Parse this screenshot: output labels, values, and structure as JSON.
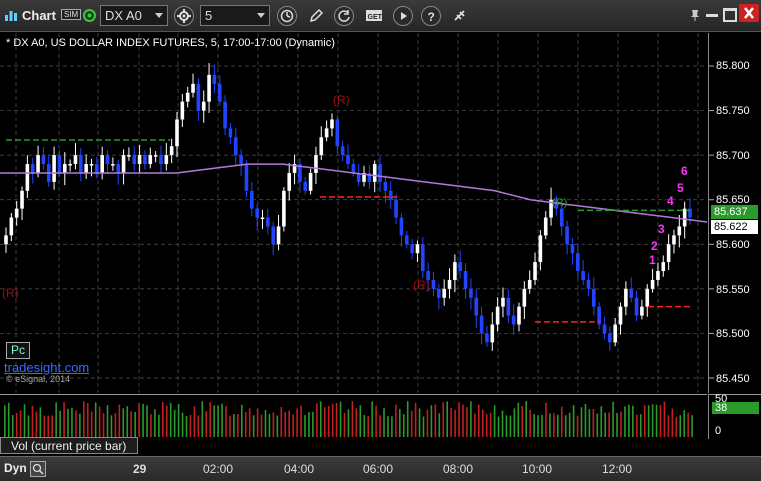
{
  "toolbar": {
    "app_label": "Chart",
    "sim_badge": "SIM",
    "symbol": "DX A0",
    "interval": "5"
  },
  "chart_title": "* DX A0, US DOLLAR INDEX FUTURES, 5, 17:00-17:00 (Dynamic)",
  "price_axis": {
    "ticks": [
      "85.800",
      "85.750",
      "85.700",
      "85.650",
      "85.600",
      "85.550",
      "85.500",
      "85.450"
    ],
    "last_price": "85.637",
    "ma_value": "85.622"
  },
  "volume_axis": {
    "ticks": [
      "50",
      "0"
    ],
    "last_volume": "38"
  },
  "volume_panel_label": "Vol (current price bar)",
  "pc_button": "Pc",
  "watermark": "tradesight.com",
  "copyright": "© eSignal, 2014",
  "time_axis": {
    "mode": "Dyn",
    "labels": [
      "29",
      "02:00",
      "04:00",
      "06:00",
      "08:00",
      "10:00",
      "12:00"
    ]
  },
  "annotations": {
    "r_left": "(R)",
    "r_top": "(R)",
    "r_mid": "(R)",
    "r_right": "(R)",
    "setup_counts": [
      "1",
      "2",
      "3",
      "4",
      "5",
      "6"
    ]
  },
  "colors": {
    "up_bar": "#ffffff",
    "down_bar": "#2244ff",
    "moving_average": "#b07ad8",
    "resistance": "#2a9a2a",
    "support": "#ff2222",
    "setup_count": "#ff33ff",
    "r_label": "#a01010"
  },
  "chart_data": {
    "type": "candlestick",
    "price_ylim": [
      85.45,
      85.82
    ],
    "x_tick_labels": [
      "29",
      "02:00",
      "04:00",
      "06:00",
      "08:00",
      "10:00",
      "12:00"
    ],
    "price_ticks": [
      85.8,
      85.75,
      85.7,
      85.65,
      85.6,
      85.55,
      85.5,
      85.45
    ],
    "close_path": [
      85.61,
      85.63,
      85.64,
      85.66,
      85.69,
      85.68,
      85.7,
      85.69,
      85.67,
      85.7,
      85.68,
      85.69,
      85.69,
      85.7,
      85.68,
      85.69,
      85.69,
      85.68,
      85.7,
      85.69,
      85.69,
      85.68,
      85.7,
      85.7,
      85.69,
      85.7,
      85.69,
      85.7,
      85.7,
      85.69,
      85.7,
      85.71,
      85.74,
      85.76,
      85.77,
      85.78,
      85.75,
      85.76,
      85.79,
      85.78,
      85.76,
      85.73,
      85.72,
      85.7,
      85.69,
      85.66,
      85.64,
      85.63,
      85.63,
      85.62,
      85.6,
      85.62,
      85.66,
      85.68,
      85.69,
      85.67,
      85.66,
      85.68,
      85.7,
      85.72,
      85.73,
      85.74,
      85.71,
      85.7,
      85.69,
      85.68,
      85.67,
      85.68,
      85.67,
      85.69,
      85.67,
      85.66,
      85.65,
      85.63,
      85.61,
      85.6,
      85.59,
      85.6,
      85.57,
      85.56,
      85.55,
      85.54,
      85.55,
      85.56,
      85.58,
      85.57,
      85.55,
      85.54,
      85.52,
      85.5,
      85.49,
      85.51,
      85.53,
      85.54,
      85.52,
      85.51,
      85.53,
      85.55,
      85.56,
      85.58,
      85.61,
      85.63,
      85.65,
      85.64,
      85.62,
      85.6,
      85.59,
      85.57,
      85.56,
      85.55,
      85.53,
      85.51,
      85.5,
      85.49,
      85.51,
      85.53,
      85.55,
      85.54,
      85.52,
      85.53,
      85.55,
      85.56,
      85.57,
      85.58,
      85.6,
      85.61,
      85.62,
      85.64,
      85.63
    ],
    "ma_path": [
      85.68,
      85.68,
      85.68,
      85.68,
      85.68,
      85.68,
      85.685,
      85.69,
      85.69,
      85.685,
      85.68,
      85.675,
      85.67,
      85.665,
      85.66,
      85.65,
      85.645,
      85.64,
      85.635,
      85.63,
      85.625
    ],
    "volume_ylim": [
      0,
      50
    ],
    "last_volume": 38,
    "levels": [
      {
        "name": "resistance-left",
        "value": 85.717,
        "color": "#2a9a2a"
      },
      {
        "name": "support-mid",
        "value": 85.653,
        "color": "#ff2222"
      },
      {
        "name": "support-right",
        "value": 85.513,
        "color": "#ff2222"
      },
      {
        "name": "resistance-right",
        "value": 85.638,
        "color": "#2a9a2a"
      },
      {
        "name": "support-far-right",
        "value": 85.53,
        "color": "#ff2222"
      }
    ]
  }
}
